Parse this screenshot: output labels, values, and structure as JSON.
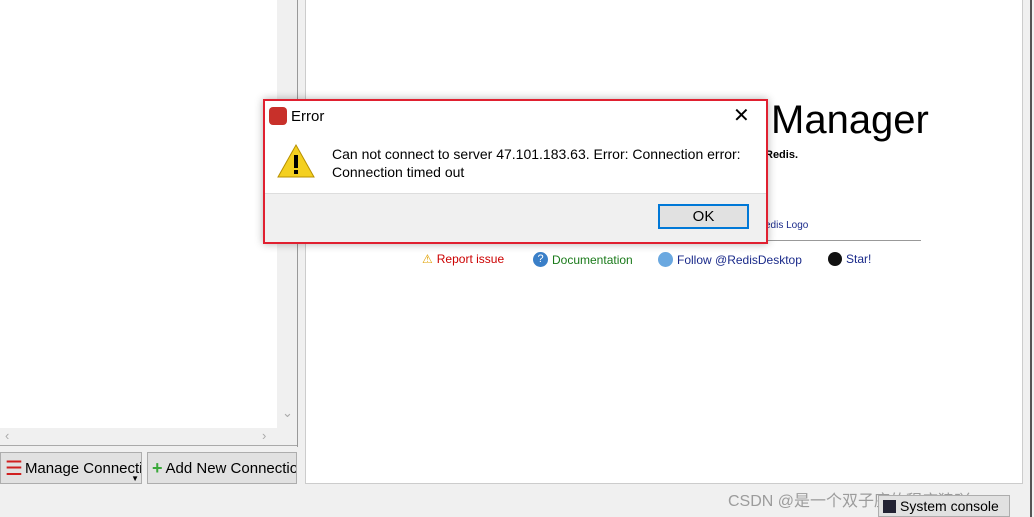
{
  "left_panel": {
    "manage_label": "Manage Connecti",
    "add_label": "Add New Connectio"
  },
  "main": {
    "title": "Manager",
    "tagline": "Redis.",
    "logo_text": "edis Logo",
    "links": [
      {
        "label": "Report issue",
        "color": "#cc0000",
        "icon": "warning-icon"
      },
      {
        "label": "Documentation",
        "color": "#1a7a1a",
        "icon": "help-icon"
      },
      {
        "label": "Follow @RedisDesktop",
        "color": "#1a2a8a",
        "icon": "twitter-icon"
      },
      {
        "label": "Star!",
        "color": "#1a2a8a",
        "icon": "github-icon"
      }
    ]
  },
  "dialog": {
    "title": "Error",
    "message": "Can not connect to server 47.101.183.63. Error: Connection error: Connection timed out",
    "ok_label": "OK",
    "border_color": "#e02030"
  },
  "statusbar": {
    "console_label": "System console"
  },
  "watermark": "CSDN @是一个双子座的程序猿吖"
}
